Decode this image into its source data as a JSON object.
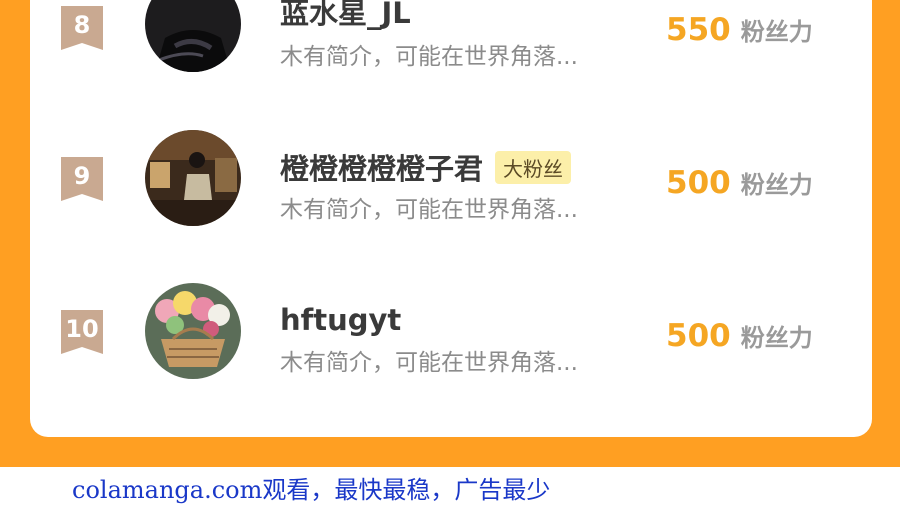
{
  "leaderboard": {
    "rows": [
      {
        "rank": "8",
        "name": "蓝水星_JL",
        "badge": "",
        "bio": "木有简介，可能在世界角落...",
        "score": "550",
        "score_unit": "粉丝力",
        "avatar_icon": "user-photo"
      },
      {
        "rank": "9",
        "name": "橙橙橙橙橙子君",
        "badge": "大粉丝",
        "bio": "木有简介，可能在世界角落...",
        "score": "500",
        "score_unit": "粉丝力",
        "avatar_icon": "user-photo"
      },
      {
        "rank": "10",
        "name": "hftugyt",
        "badge": "",
        "bio": "木有简介，可能在世界角落...",
        "score": "500",
        "score_unit": "粉丝力",
        "avatar_icon": "flower-basket-photo"
      }
    ]
  },
  "footer": {
    "text": "colamanga.com观看，最快最稳，广告最少"
  },
  "colors": {
    "background": "#ff9f22",
    "score": "#f5a623",
    "badge_bg": "#fcefa9",
    "rank_badge": "#c9a991",
    "footer_link": "#1a38c8"
  }
}
